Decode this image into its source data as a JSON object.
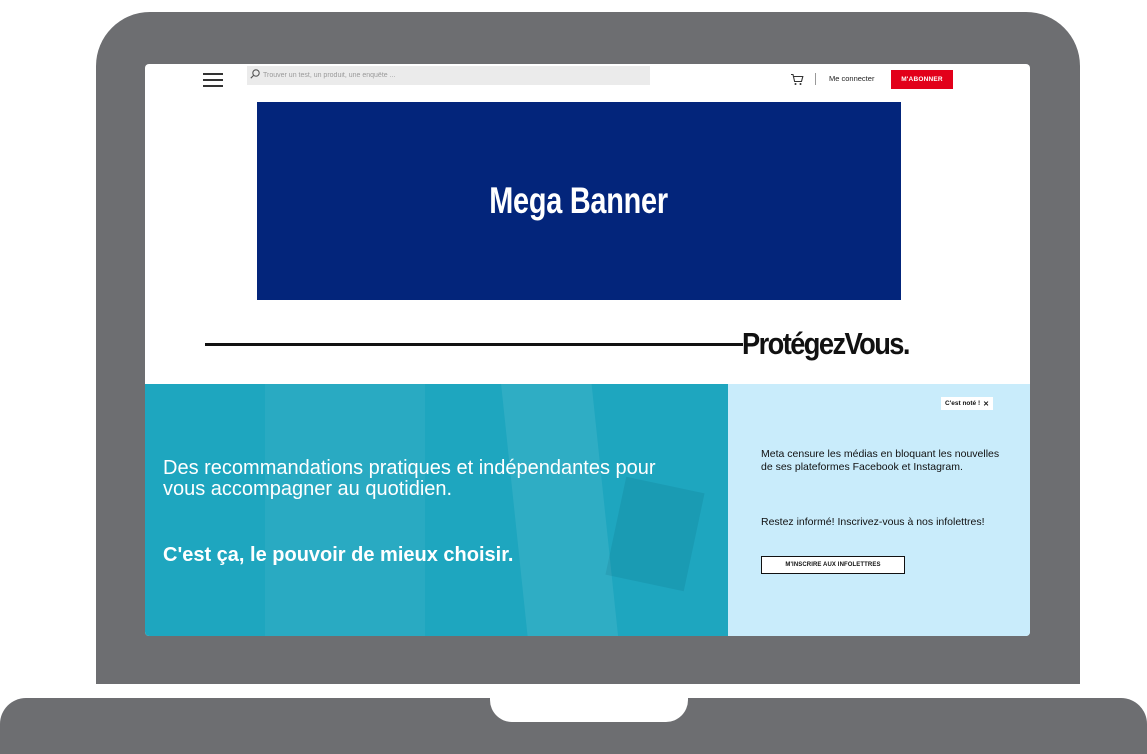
{
  "topbar": {
    "search_placeholder": "Trouver un test, un produit, une enquête ...",
    "login_label": "Me connecter",
    "subscribe_label": "M'ABONNER"
  },
  "banner": {
    "label": "Mega Banner"
  },
  "brand": {
    "logo_text": "ProtégezVous."
  },
  "hero": {
    "text": "Des recommandations pratiques et indépendantes pour vous accompagner au quotidien.",
    "tagline": "C'est ça, le pouvoir de mieux choisir."
  },
  "notice": {
    "dismiss_label": "C'est noté !",
    "dismiss_icon": "close-icon",
    "text1": "Meta censure les médias en bloquant les nouvelles de ses plateformes Facebook et Instagram.",
    "text2": "Restez informé! Inscrivez-vous à nos infolettres!",
    "button_label": "M'INSCRIRE AUX INFOLETTRES"
  },
  "colors": {
    "laptop_frame": "#6d6e71",
    "banner_bg": "#03257b",
    "subscribe_bg": "#e2001a",
    "hero_bg": "#1ea6bf",
    "panel_bg": "#c9ecfb"
  }
}
